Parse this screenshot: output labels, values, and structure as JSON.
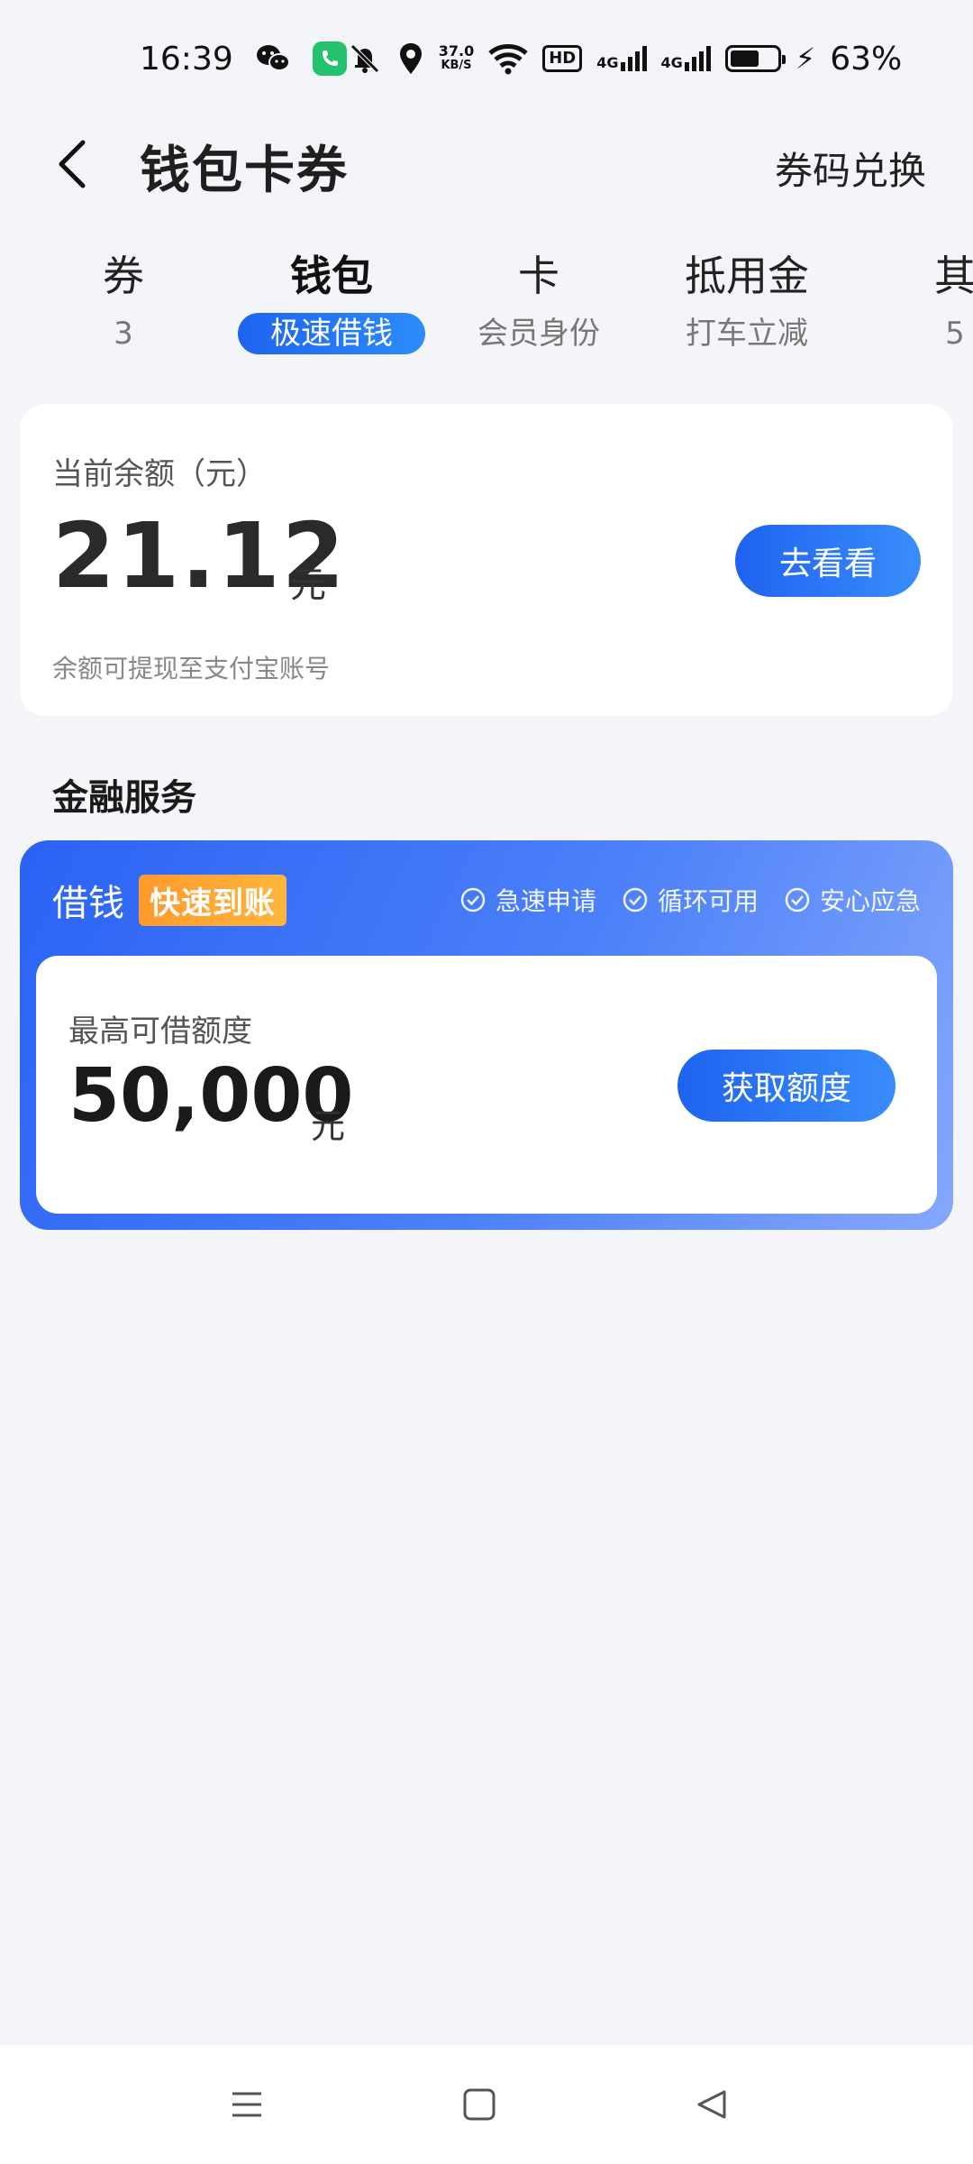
{
  "status_bar": {
    "time": "16:39",
    "speed_value": "37.0",
    "speed_unit": "KB/S",
    "hd": "HD",
    "net1": "4G",
    "net2": "4G",
    "battery_percent_text": "63%",
    "battery_level": 0.63,
    "icons": [
      "wechat-icon",
      "phone-icon",
      "mute-icon",
      "location-icon",
      "wifi-icon",
      "signal-icon",
      "battery-icon",
      "charging-icon"
    ]
  },
  "header": {
    "title": "钱包卡券",
    "action": "券码兑换"
  },
  "tabs": [
    {
      "title": "券",
      "sub": "3"
    },
    {
      "title": "钱包",
      "sub": "极速借钱",
      "active": true
    },
    {
      "title": "卡",
      "sub": "会员身份"
    },
    {
      "title": "抵用金",
      "sub": "打车立减"
    },
    {
      "title": "其",
      "sub": "5"
    }
  ],
  "balance": {
    "label": "当前余额（元）",
    "amount": "21.12",
    "unit": "元",
    "button": "去看看",
    "note": "余额可提现至支付宝账号"
  },
  "finance": {
    "section_title": "金融服务",
    "loan_title": "借钱",
    "badge": "快速到账",
    "features": [
      "急速申请",
      "循环可用",
      "安心应急"
    ],
    "credit_label": "最高可借额度",
    "credit_amount": "50,000",
    "credit_unit": "元",
    "button": "获取额度"
  },
  "colors": {
    "accent": "#1e63f0",
    "background": "#f4f5f8",
    "badge": "#ff9a2e"
  }
}
